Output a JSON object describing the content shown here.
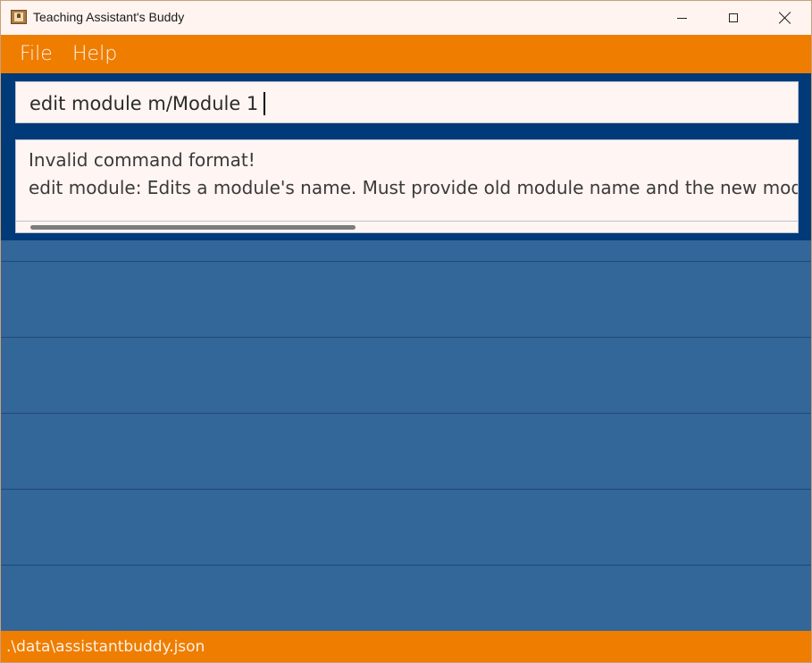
{
  "window": {
    "title": "Teaching Assistant's Buddy"
  },
  "menu": {
    "items": [
      "File",
      "Help"
    ]
  },
  "command": {
    "value": "edit module m/Module 1"
  },
  "result": {
    "line1": "Invalid command format!",
    "line2": "edit module: Edits a module's name. Must provide old module name and the new module"
  },
  "list": {
    "rows": 5
  },
  "status": {
    "path": ".\\data\\assistantbuddy.json"
  },
  "colors": {
    "accent": "#ee7d00",
    "command_area": "#003a78",
    "list_background": "#336699"
  }
}
